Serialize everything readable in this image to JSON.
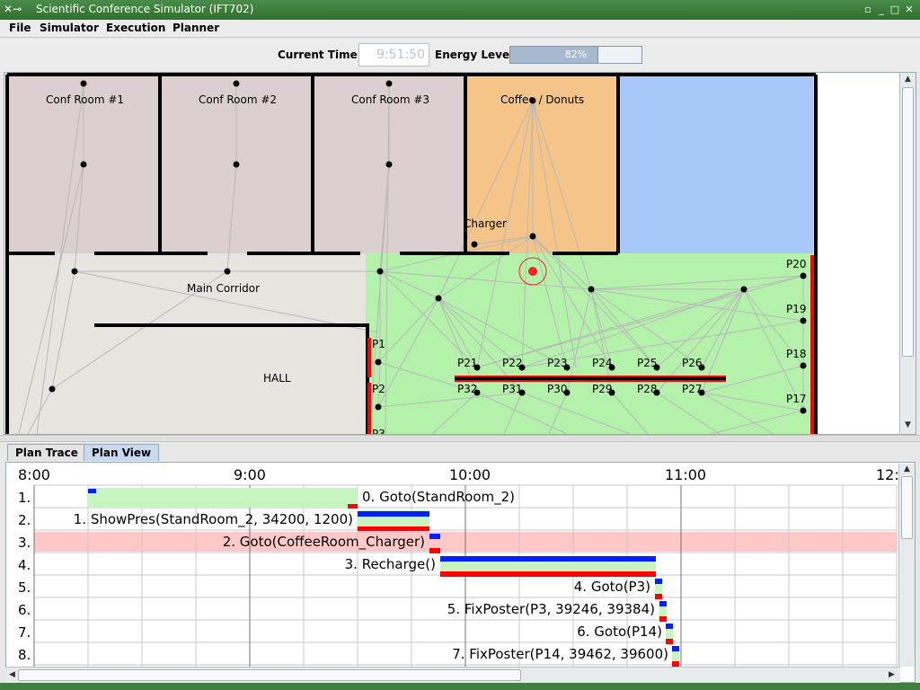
{
  "window": {
    "title": "Scientific Conference Simulator (IFT702)",
    "icon": "app-icon"
  },
  "menu": [
    "File",
    "Simulator",
    "Execution",
    "Planner"
  ],
  "toolbar": {
    "time_label": "Current Time:",
    "time_value": "9:51:50",
    "energy_label": "Energy Level",
    "energy_text": "82%",
    "energy_fraction": 0.82
  },
  "map": {
    "rooms": {
      "conf1": "Conf Room #1",
      "conf2": "Conf Room #2",
      "conf3": "Conf Room #3",
      "coffee": "Coffee / Donuts",
      "charger": "Charger",
      "corridor": "Main Corridor",
      "hall": "HALL"
    },
    "posters_left": [
      "P1",
      "P2",
      "P3"
    ],
    "posters_right": [
      "P20",
      "P19",
      "P18",
      "P17"
    ],
    "posters_top_row": [
      "P21",
      "P22",
      "P23",
      "P24",
      "P25",
      "P26"
    ],
    "posters_bottom_row": [
      "P32",
      "P31",
      "P30",
      "P29",
      "P28",
      "P27"
    ],
    "colors": {
      "conf": "#dccfcf",
      "coffee": "#f5c488",
      "water": "#a7c8f8",
      "green": "#b4f2ac",
      "corridor": "#e8e4e0",
      "robot": "#ff2020"
    }
  },
  "tabs": [
    "Plan Trace",
    "Plan View"
  ],
  "active_tab": "Plan View",
  "plan": {
    "time_labels": [
      "8:00",
      "9:00",
      "10:00",
      "11:00",
      "12:"
    ],
    "row_numbers": [
      "1.",
      "2.",
      "3.",
      "4.",
      "5.",
      "6.",
      "7.",
      "8."
    ],
    "actions": [
      "0. Goto(StandRoom_2)",
      "1. ShowPres(StandRoom_2, 34200, 1200)",
      "2. Goto(CoffeeRoom_Charger)",
      "3. Recharge()",
      "4. Goto(P3)",
      "5. FixPoster(P3, 39246, 39384)",
      "6. Goto(P14)",
      "7. FixPoster(P14, 39462, 39600)"
    ],
    "colors": {
      "planned": "#0020ff",
      "actual": "#ff0000",
      "span": "#c8f4c0",
      "highlight": "#ffc8c8"
    }
  }
}
